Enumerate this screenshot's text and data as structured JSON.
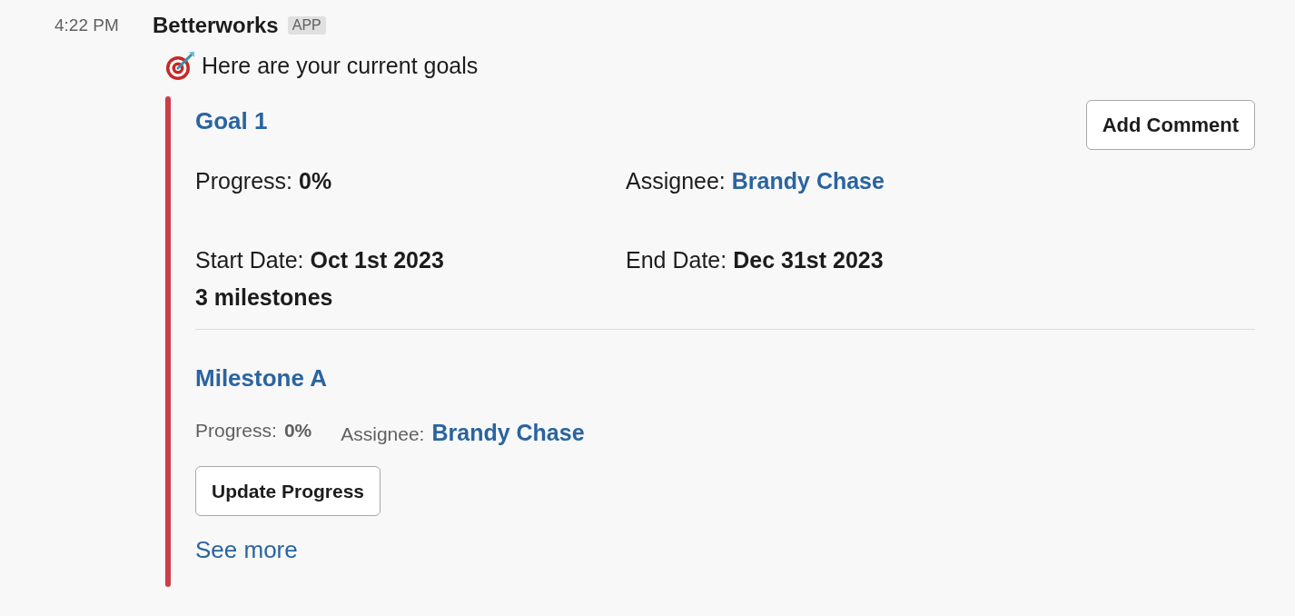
{
  "message": {
    "time": "4:22 PM",
    "sender": "Betterworks",
    "badge": "APP",
    "text": "Here are your current goals"
  },
  "goal": {
    "title": "Goal 1",
    "button": "Add Comment",
    "fields": [
      {
        "label": "Progress:",
        "value": "0%",
        "kind": "bold"
      },
      {
        "label": "Assignee:",
        "value": "Brandy Chase",
        "kind": "link"
      },
      {
        "label": "Start Date:",
        "value": "Oct 1st 2023",
        "kind": "bold"
      },
      {
        "label": "End Date:",
        "value": "Dec 31st 2023",
        "kind": "bold"
      }
    ],
    "milestone_count": "3 milestones"
  },
  "milestone": {
    "title": "Milestone A",
    "fields": [
      {
        "label": "Progress:",
        "value": "0%",
        "kind": "bold"
      },
      {
        "label": "Assignee:",
        "value": "Brandy Chase",
        "kind": "link"
      }
    ],
    "button": "Update Progress"
  },
  "see_more": "See more"
}
